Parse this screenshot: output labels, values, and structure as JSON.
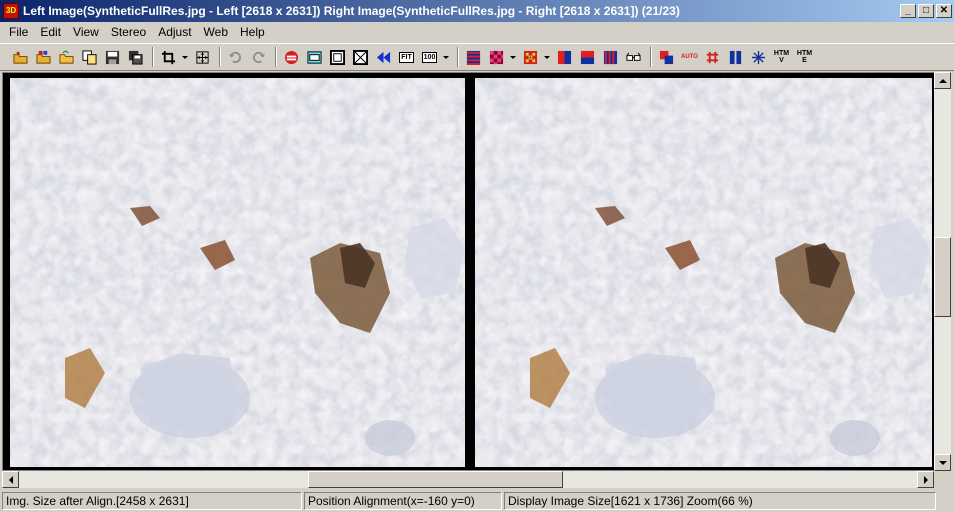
{
  "window": {
    "title": "Left Image(SyntheticFullRes.jpg - Left [2618 x 2631]) Right Image(SyntheticFullRes.jpg - Right [2618 x 2631])  (21/23)",
    "app_icon_text": "3D",
    "controls": {
      "minimize": "_",
      "maximize": "□",
      "close": "✕"
    }
  },
  "menu": [
    "File",
    "Edit",
    "View",
    "Stereo",
    "Adjust",
    "Web",
    "Help"
  ],
  "toolbar": {
    "fit_label": "FIT",
    "zoom100_label": "100",
    "auto_label": "AUTO",
    "html_v_label": "HTM V",
    "html_e_label": "HTM E"
  },
  "images": {
    "left_name": "left-image-pane",
    "right_name": "right-image-pane"
  },
  "scroll": {
    "vertical_position": 0.52,
    "horizontal_position": 0.45
  },
  "status": {
    "img_size": "Img. Size after Align.[2458 x 2631]",
    "position": "Position Alignment(x=-160 y=0)",
    "display": "Display Image Size[1621 x 1736]  Zoom(66 %)"
  },
  "colors": {
    "title_start": "#0a246a",
    "title_end": "#a6caf0",
    "face": "#d4d0c8",
    "stone_base": "#e9e8ec"
  }
}
